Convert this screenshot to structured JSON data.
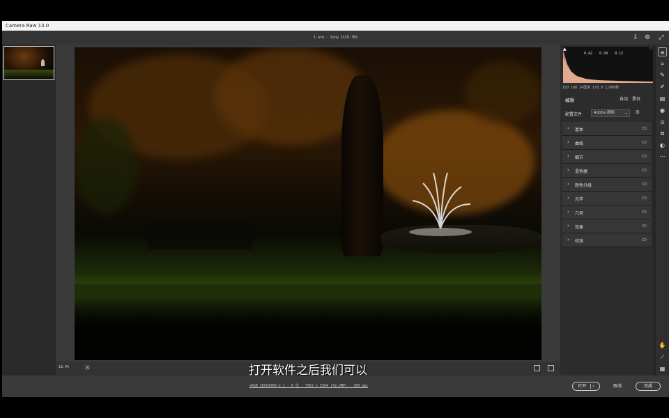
{
  "window": {
    "title": "Camera Raw 13.0"
  },
  "topbar": {
    "file_info": "1 arw · Sony ILCE-7M2"
  },
  "histogram": {
    "values": "0.42 0.34 0.12"
  },
  "camera_info": "ISO 160   24毫米   ƒ/8.0   1/800秒",
  "panel": {
    "header": "编辑",
    "btn_auto": "自动",
    "btn_bw": "黑白",
    "profile_label": "配置文件",
    "profile_value": "Adobe 颜色",
    "sections": [
      {
        "label": "基本"
      },
      {
        "label": "曲线"
      },
      {
        "label": "细节"
      },
      {
        "label": "混色器"
      },
      {
        "label": "颜色分级"
      },
      {
        "label": "光学"
      },
      {
        "label": "几何"
      },
      {
        "label": "效果"
      },
      {
        "label": "校准"
      }
    ]
  },
  "bottombar": {
    "zoom": "18.9%",
    "subtitle": "打开软件之后我们可以"
  },
  "footer": {
    "info": "sRGB IEC61966-2.1 - 8 位 - 7952 x 5304 (42.2MP) - 300 ppi",
    "open_label": "打开",
    "cancel_label": "取消",
    "done_label": "完成"
  },
  "icons": {
    "save": "save-icon",
    "settings": "gear-icon",
    "fullscreen": "expand-icon"
  }
}
